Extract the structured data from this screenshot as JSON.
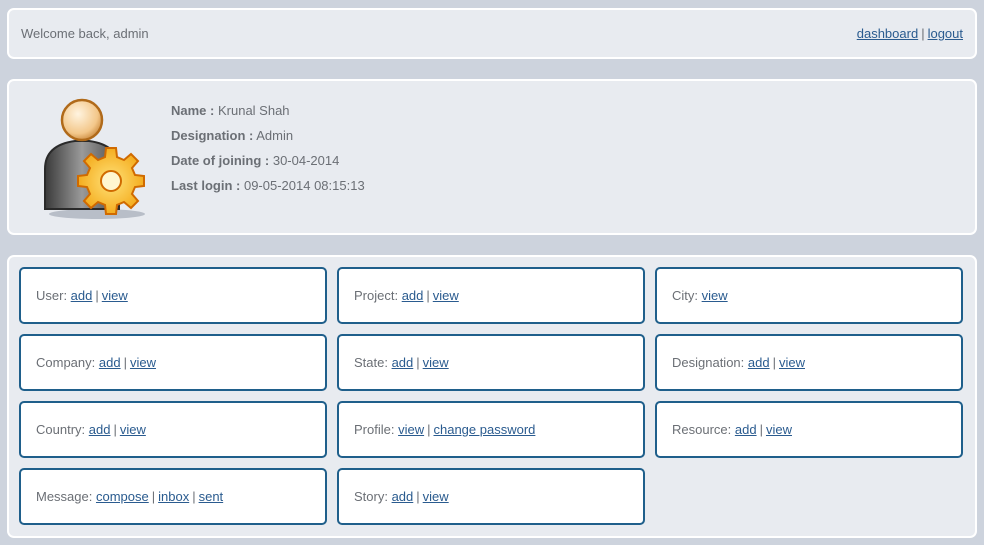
{
  "header": {
    "welcome": "Welcome back, admin",
    "nav": [
      {
        "label": "dashboard"
      },
      {
        "label": "logout"
      }
    ]
  },
  "profile": {
    "avatar_icon": "admin-user-gear-icon",
    "fields": [
      {
        "label": "Name :",
        "value": "Krunal Shah"
      },
      {
        "label": "Designation :",
        "value": "Admin"
      },
      {
        "label": "Date of joining :",
        "value": "30-04-2014"
      },
      {
        "label": "Last login :",
        "value": "09-05-2014 08:15:13"
      }
    ]
  },
  "modules": [
    {
      "name": "User:",
      "links": [
        "add",
        "view"
      ]
    },
    {
      "name": "Company:",
      "links": [
        "add",
        "view"
      ]
    },
    {
      "name": "Country:",
      "links": [
        "add",
        "view"
      ]
    },
    {
      "name": "Message:",
      "links": [
        "compose",
        "inbox",
        "sent"
      ]
    },
    {
      "name": "Project:",
      "links": [
        "add",
        "view"
      ]
    },
    {
      "name": "State:",
      "links": [
        "add",
        "view"
      ]
    },
    {
      "name": "Profile:",
      "links": [
        "view",
        "change password"
      ]
    },
    {
      "name": "Story:",
      "links": [
        "add",
        "view"
      ]
    },
    {
      "name": "City:",
      "links": [
        "view"
      ]
    },
    {
      "name": "Designation:",
      "links": [
        "add",
        "view"
      ]
    },
    {
      "name": "Resource:",
      "links": [
        "add",
        "view"
      ]
    }
  ],
  "colors": {
    "link": "#2a5b8f",
    "card_border": "#1f5f8b",
    "background": "#cdd3dd",
    "panel": "#e8ebf0"
  }
}
